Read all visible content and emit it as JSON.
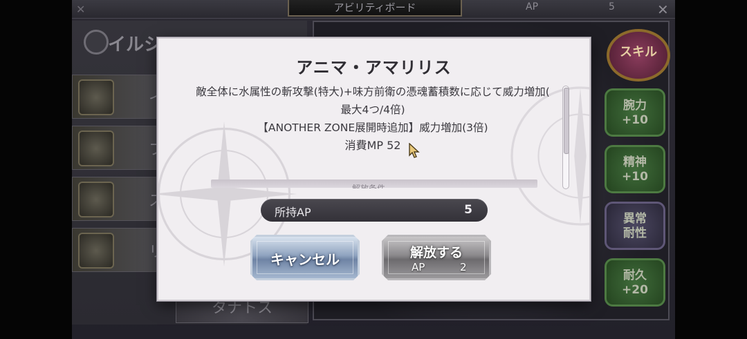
{
  "background": {
    "tab_title": "アビリティボード",
    "ap_label": "AP",
    "ap_value": "5",
    "close_left": "✕",
    "close_right": "✕",
    "character_name": "イルシ",
    "list_items": [
      "イ",
      "フ",
      "ス",
      "リ"
    ],
    "bottom_name": "タナトス",
    "skill_badge": "スキル",
    "stats": [
      {
        "line1": "腕力",
        "line2": "+10"
      },
      {
        "line1": "精神",
        "line2": "+10"
      },
      {
        "line1": "異常",
        "line2": "耐性"
      },
      {
        "line1": "耐久",
        "line2": "+20"
      }
    ]
  },
  "dialog": {
    "title": "アニマ・アマリリス",
    "description": [
      "敵全体に水属性の斬攻撃(特大)+味方前衛の憑魂蓄積数に応じて威力増加(",
      "最大4つ/4倍)",
      "【ANOTHER ZONE展開時追加】威力増加(3倍)"
    ],
    "cost": "消費MP 52",
    "section_label": "解放条件",
    "owned_ap_label": "所持AP",
    "owned_ap_value": "5",
    "cancel_button": "キャンセル",
    "release_button": "解放する",
    "release_ap_label": "AP",
    "release_ap_value": "2"
  },
  "colors": {
    "dialog_bg": "#f1eef1",
    "pill_bg": "#3d3b42",
    "cancel_accent": "#8fa3bf",
    "release_accent": "#8a888b"
  }
}
